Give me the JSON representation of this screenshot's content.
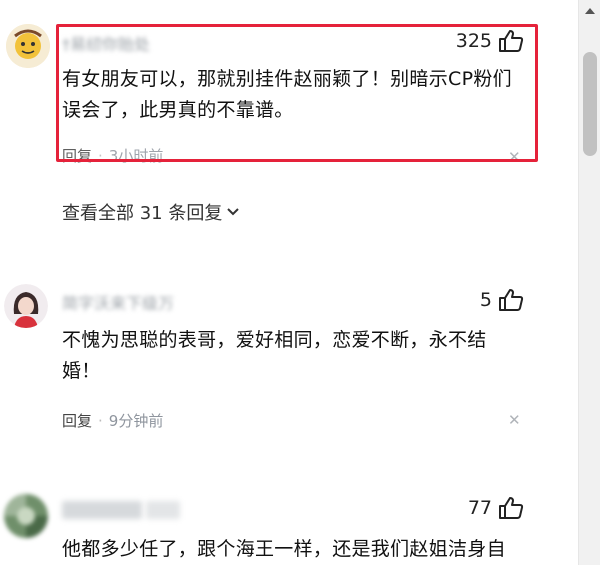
{
  "comments": [
    {
      "username": "†易纫你贻处",
      "likes": "325",
      "content_line1": "有女朋友可以，那就别挂件赵丽颖了！别暗示CP粉们",
      "content_line2": "误会了，此男真的不靠谱。",
      "reply_label": "回复",
      "time": "3小时前"
    },
    {
      "username": "简字沃来下级万",
      "likes": "5",
      "content_line1": "不愧为思聪的表哥，爱好相同，恋爱不断，永不结",
      "content_line2": "婚！",
      "reply_label": "回复",
      "time": "9分钟前"
    },
    {
      "username": "",
      "likes": "77",
      "content_line1": "他都多少任了，跟个海王一样，还是我们赵姐洁身自"
    }
  ],
  "view_all_replies": "查看全部 31 条回复",
  "colors": {
    "highlight": "#e5223a",
    "muted": "#8f959e"
  },
  "icons": [
    "thumb-up-icon",
    "close-icon",
    "chevron-down-icon",
    "scroll-up-arrow-icon"
  ]
}
